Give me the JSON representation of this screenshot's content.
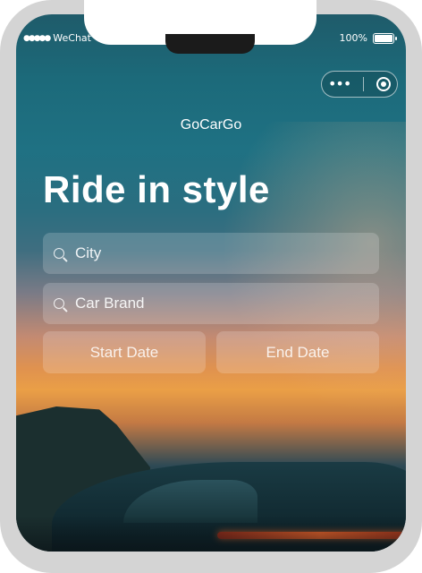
{
  "status_bar": {
    "carrier": "WeChat",
    "signal_dots": "●●●●●",
    "battery_percent": "100%"
  },
  "capsule": {
    "more_icon": "more-dots-icon",
    "close_icon": "target-close-icon"
  },
  "app": {
    "title": "GoCarGo",
    "hero_text": "Ride in style"
  },
  "search": {
    "city_placeholder": "City",
    "brand_placeholder": "Car Brand",
    "start_date_label": "Start Date",
    "end_date_label": "End Date"
  }
}
